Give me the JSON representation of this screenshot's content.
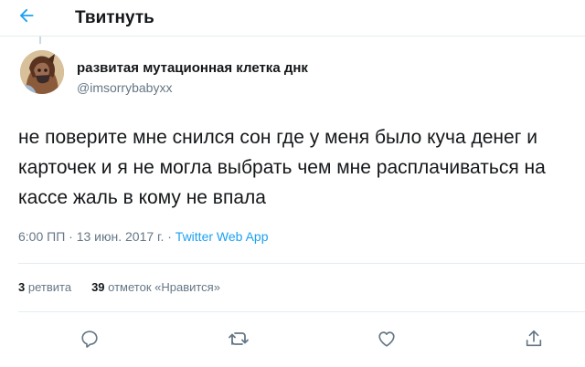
{
  "header": {
    "title": "Твитнуть",
    "back_icon": "arrow-left-icon"
  },
  "colors": {
    "accent": "#1da1f2",
    "text": "#14171a",
    "secondary": "#657786",
    "border": "#e6ecf0"
  },
  "tweet": {
    "display_name": "развитая мутационная клетка днк",
    "handle": "@imsorrybabyxx",
    "text": "не поверите мне снился сон где у меня было куча денег и карточек и я не могла выбрать чем мне расплачиваться на кассе жаль в кому не впала",
    "time": "6:00 ПП",
    "separator1": " · ",
    "date": "13 июн. 2017 г.",
    "separator2": " · ",
    "source": "Twitter Web App"
  },
  "stats": {
    "retweets_count": "3",
    "retweets_label": "ретвита",
    "likes_count": "39",
    "likes_label": "отметок «Нравится»"
  },
  "actions": {
    "reply_icon": "reply-icon",
    "retweet_icon": "retweet-icon",
    "like_icon": "heart-icon",
    "share_icon": "share-icon"
  }
}
